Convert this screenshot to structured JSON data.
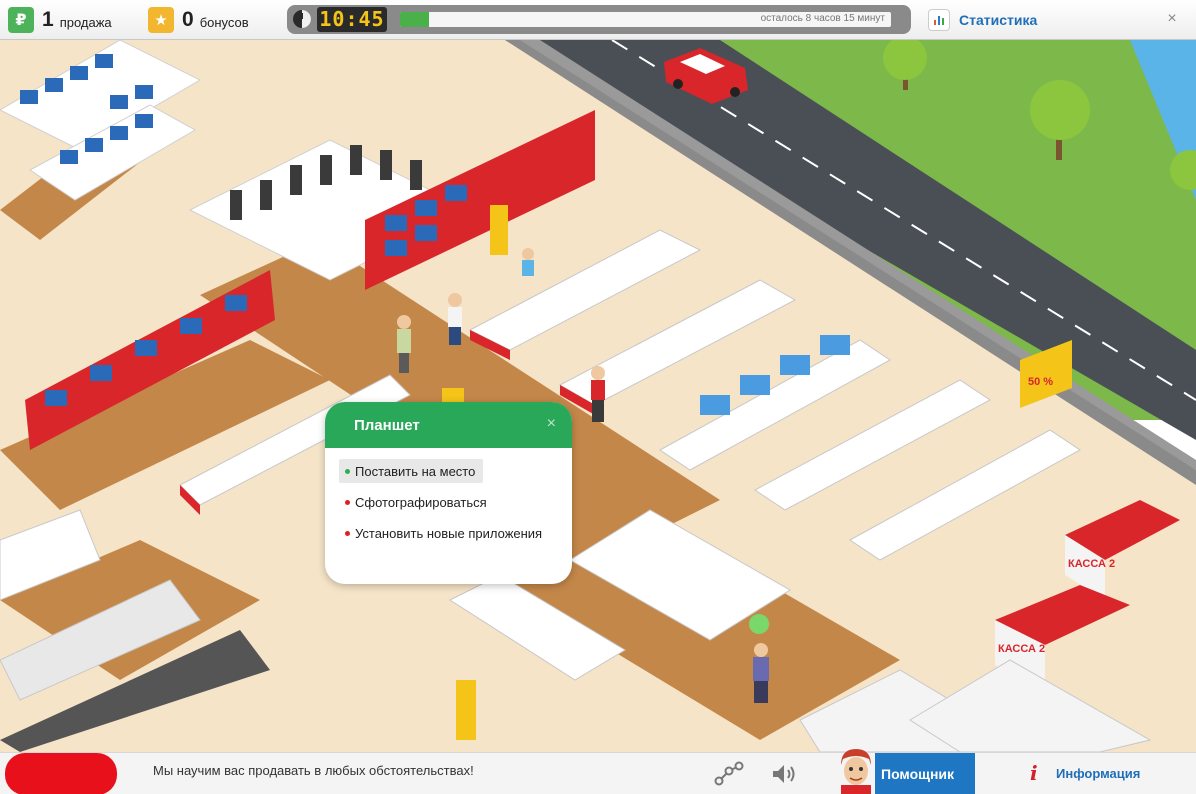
{
  "topbar": {
    "sales_count": "1",
    "sales_label": "продажа",
    "sales_icon": "ruble-icon",
    "bonus_count": "0",
    "bonus_label": "бонусов",
    "bonus_icon": "star-icon",
    "clock_time": "10:45",
    "time_progress": 0.06,
    "time_left_text": "осталось 8 часов 15 минут",
    "stats_label": "Статистика",
    "close_symbol": "×"
  },
  "scene": {
    "cashier_labels": [
      "КАССА 2",
      "КАССА 2"
    ],
    "sale_sign": "50 %"
  },
  "popup": {
    "title": "Планшет",
    "close_symbol": "×",
    "options": [
      "Поставить на место",
      "Сфотографироваться",
      "Установить новые приложения"
    ],
    "selected_index": 0
  },
  "bottombar": {
    "message": "Мы научим вас продавать в любых обстоятельствах!",
    "helper_label": "Помощник",
    "info_label": "Информация",
    "info_symbol": "i"
  },
  "colors": {
    "accent_green": "#29a85a",
    "brand_red": "#e8101a",
    "link_blue": "#1f6fb8",
    "helper_blue": "#1f77c4"
  }
}
